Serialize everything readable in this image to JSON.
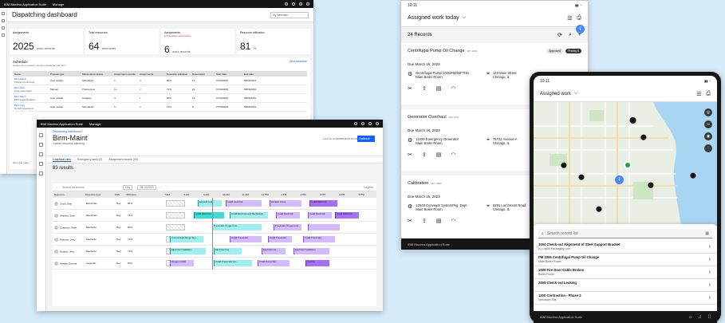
{
  "dashboard": {
    "brand": "IBM Maximo Application Suite",
    "brand_suffix": "Manage",
    "title": "Dispatching dashboard",
    "site_select": "My selection",
    "cards": [
      {
        "label": "Assignments",
        "value": "2025",
        "unit": "work records",
        "sub": ""
      },
      {
        "label": "Total resources",
        "value": "64",
        "unit": "resources",
        "sub": ""
      },
      {
        "label": "Assignments",
        "value": "6",
        "unit": "work records",
        "sub": "● 6 Overdue work orders"
      },
      {
        "label": "Resource utilization",
        "value": "81",
        "unit": "%",
        "sub": ""
      }
    ],
    "schedule": {
      "title": "Schedule",
      "subtitle": "Assignment requests needing dispatcher attention",
      "link": "View schedule",
      "columns": [
        "Name",
        "Process type",
        "Maintenance status",
        "Assignment records",
        "Assignments",
        "Resource utilization",
        "Reservation",
        "Start date",
        "End date"
      ],
      "rows": [
        {
          "name": "Birm-Maint",
          "sub": "Tollcott Community",
          "type": "Auto update",
          "status": "Scheduled",
          "recs": "2",
          "assign": "3",
          "util": "80%",
          "res": "12",
          "start": "07/03/2023",
          "end": "08/06/2023"
        },
        {
          "name": "Birm-Elec",
          "sub": "Area east region",
          "type": "Manual",
          "status": "Preferences",
          "recs": "11",
          "assign": "2",
          "util": "72%",
          "res": "24",
          "start": "07/03/2023",
          "end": "08/06/2023"
        },
        {
          "name": "Birm-Mech",
          "sub": "BPO Level Rotation",
          "type": "Auto update",
          "status": "Capacity",
          "recs": "4",
          "assign": "1",
          "util": "80%",
          "res": "16",
          "start": "07/03/2023",
          "end": "08/06/2023"
        },
        {
          "name": "Birm-Insp",
          "sub": "IS Toll Inspections",
          "type": "Auto update",
          "status": "Scheduled",
          "recs": "5",
          "assign": "0",
          "util": "72%",
          "res": "8",
          "start": "07/03/2023",
          "end": "08/06/2023"
        }
      ],
      "footer_left": "Items per page"
    }
  },
  "birm": {
    "brand": "IBM Maximo Application Suite",
    "brand_suffix": "Manage",
    "crumb": "Dispatching dashboard /",
    "title": "Birm-Maint",
    "subtitle": "1 week resource planning",
    "updated": "Last run by 06/08/2023 8:30 PM",
    "primary": "Optimize",
    "tabs": [
      "Graphical view",
      "Emergency work (3)",
      "Assignment Issues (16)"
    ],
    "results": "83 results",
    "toolbar": {
      "search": "Search resources",
      "period": "Day",
      "date": "08/15/2023",
      "legend": "Legend"
    },
    "columns": [
      "Resource",
      "Resource type",
      "Shift",
      "Utilization"
    ],
    "hours": [
      "7 AM",
      "8 AM",
      "9 AM",
      "10 AM",
      "11 AM",
      "12 PM",
      "1 PM",
      "2 PM",
      "3 PM",
      "4 PM",
      "5 PM"
    ],
    "rows": [
      {
        "name": "Smith, Alan",
        "type": "Electrician",
        "shift": "Day",
        "util": "80%"
      },
      {
        "name": "Whitney, Sean",
        "type": "Electrician",
        "shift": "Day",
        "util": "76%"
      },
      {
        "name": "Costanzo, Ryan",
        "type": "Mechanic",
        "shift": "Day",
        "util": "80%"
      },
      {
        "name": "Pearson, Jerry",
        "type": "Mechanic",
        "shift": "Day",
        "util": "72%"
      },
      {
        "name": "Hudson, Jerry",
        "type": "Mechanic",
        "shift": "Day",
        "util": "72%"
      },
      {
        "name": "Nakata, Daniela",
        "type": "Inspector",
        "shift": "Day",
        "util": "60%"
      }
    ],
    "bars": [
      [
        "Exhaust Leak",
        "Install electrical",
        "Exhaust check",
        "Install Electrical"
      ],
      [
        "Install Electrical",
        "Install Electrical and Mechanical",
        "Install Electrical",
        "Install Electrical",
        "Install Electrical"
      ],
      [
        "Pneumatic Oxygen Installation",
        "Pneumatic Oxygen Inst...",
        "Pneumatic Oxygen Inst..."
      ],
      [
        "Current High Range Sen...",
        "Install Pneumatic",
        "Install Pneumatic",
        "Install Pneumatic"
      ],
      [
        "Electrical Installation",
        "Electrical Inst...",
        "Electrical ma...",
        "Electrical Installation"
      ],
      [
        "Oxygen Install",
        "Install Pneumatic Ins...",
        "Install Pneumatic",
        "Training"
      ]
    ]
  },
  "tablet": {
    "time": "10:11",
    "status_right": "▮▮ ◔",
    "title": "Assigned work today",
    "records": "24 Records",
    "workorders": [
      {
        "title": "Centrifugal Pump Oil Change",
        "id": "WO 1001",
        "status": "Approved",
        "priority": "Priority 5",
        "due": "Due March 16, 2023",
        "asset": "Centrifugal Pump 100GPM/60FTHD",
        "asset_loc": "Main Boiler Room",
        "addr1": "123 Main Street",
        "addr2": "Chicago, IL"
      },
      {
        "title": "Generator Overhaul",
        "id": "WO 1027",
        "status": "Approved",
        "priority": "",
        "due": "Due March 16, 2023",
        "asset": "11230 Emergency Generator",
        "asset_loc": "Main Boiler Room",
        "addr1": "78722 Avenue A",
        "addr2": "Chicago, IL"
      },
      {
        "title": "Calibration",
        "id": "WO 1028",
        "status": "Approved",
        "priority": "",
        "due": "Due March 15, 2023",
        "asset": "12548 Conveyor SystemPkg. Dept.",
        "asset_loc": "Main Boiler Room",
        "addr1": "6291 Larchmont Road",
        "addr2": "Chicago, IL"
      }
    ],
    "footer": "IBM Maximo Application Suite"
  },
  "phone": {
    "time": "10:11",
    "status_right": "▮▮ ◔",
    "title": "Assigned work",
    "search_placeholder": "Search record list",
    "items": [
      {
        "title": "1004 Check-out Alignment of Steel Support Bracket",
        "sub": "#1 Liquid Packaging Line"
      },
      {
        "title": "PM 1006 Centrifugal Pump Oil Change",
        "sub": "Main Boiler Room"
      },
      {
        "title": "1009 Fire Door Cable Broken",
        "sub": "Boiler Room"
      },
      {
        "title": "2005 Check-out Leaking",
        "sub": ""
      },
      {
        "title": "1200 Contraction - Phase 2",
        "sub": "Needham Site"
      }
    ],
    "footer": "IBM Maximo Application Suite"
  },
  "colors": {
    "accent": "#0f62fe",
    "dark": "#161616",
    "background": "#d7ecf9",
    "teal": "#9ef0f0",
    "purple": "#d4bbff"
  }
}
